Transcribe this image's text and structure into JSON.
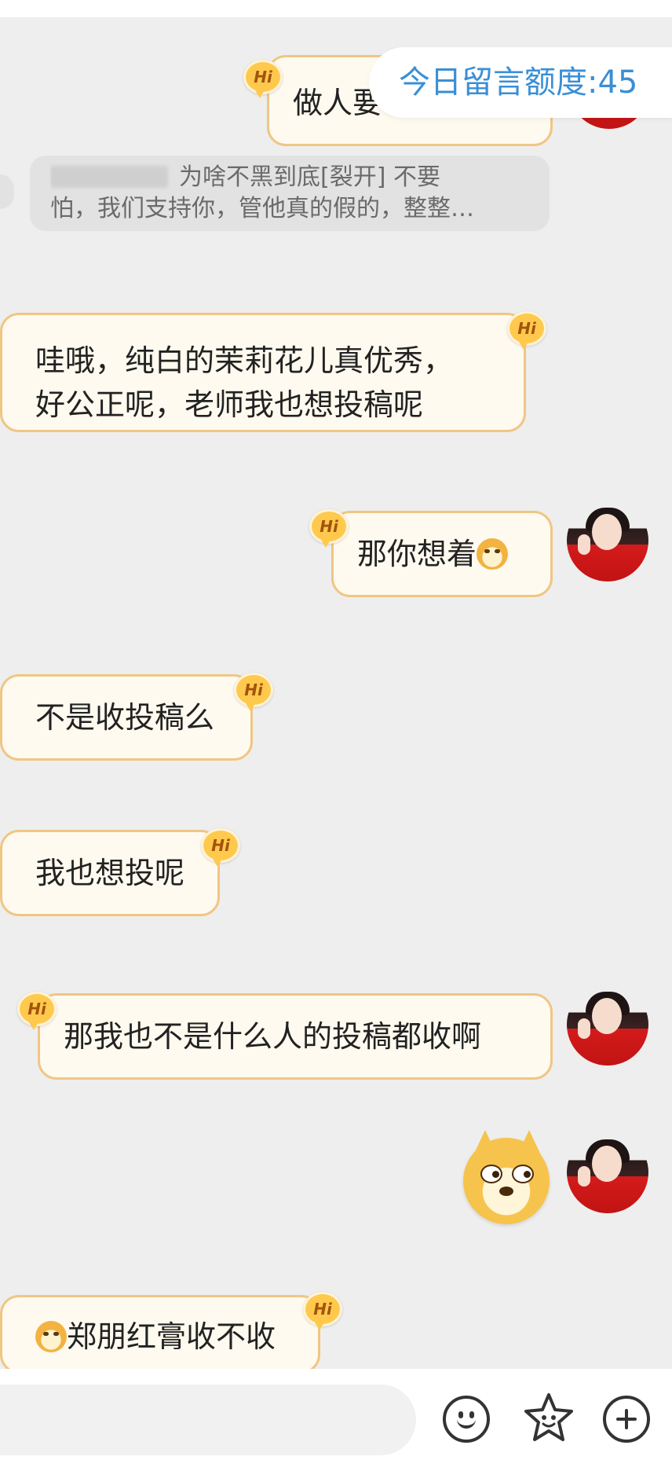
{
  "quota": {
    "label": "今日留言额度:45"
  },
  "messages": {
    "m1": {
      "text": "做人要"
    },
    "quote": {
      "line1": "为啥不黑到底[裂开] 不要",
      "line2": "怕，我们支持你，管他真的假的，整整…"
    },
    "m2": {
      "line1": "哇哦，纯白的茉莉花儿真优秀，",
      "line2": "好公正呢，老师我也想投稿呢"
    },
    "m3": {
      "text": "那你想着"
    },
    "m4": {
      "text": "不是收投稿么"
    },
    "m5": {
      "text": "我也想投呢"
    },
    "m6": {
      "text": "那我也不是什么人的投稿都收啊"
    },
    "m8": {
      "text": "郑朋红膏收不收"
    }
  },
  "badge": {
    "label": "Hi"
  },
  "icons": {
    "avatar": "avatar-girl-red-sweater",
    "sticker": "doge-sticker",
    "emoji": "smile-icon",
    "favorites": "star-face-icon",
    "add": "plus-icon"
  },
  "colors": {
    "bubble_bg": "#fffaef",
    "bubble_border": "#f0c684",
    "quota_text": "#3a8fd6",
    "background": "#eeeeee"
  }
}
